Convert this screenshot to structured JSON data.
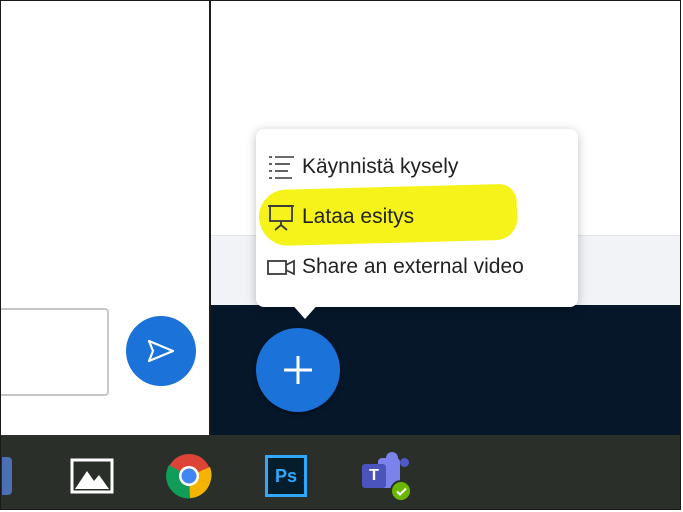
{
  "menu": {
    "items": [
      {
        "label": "Käynnistä kysely",
        "icon": "poll-list-icon"
      },
      {
        "label": "Lataa esitys",
        "icon": "presentation-icon",
        "highlighted": true
      },
      {
        "label": "Share an external video",
        "icon": "external-video-icon"
      }
    ]
  },
  "taskbar": {
    "apps": [
      {
        "name": "photos",
        "icon": "photos-icon"
      },
      {
        "name": "chrome",
        "icon": "chrome-icon"
      },
      {
        "name": "photoshop",
        "icon": "photoshop-icon",
        "label": "Ps"
      },
      {
        "name": "teams",
        "icon": "teams-icon",
        "label": "T"
      }
    ]
  },
  "colors": {
    "accent": "#1b72d9",
    "highlight": "#f5f31a",
    "action_bar": "#06172a",
    "taskbar": "#2b2f2a"
  }
}
